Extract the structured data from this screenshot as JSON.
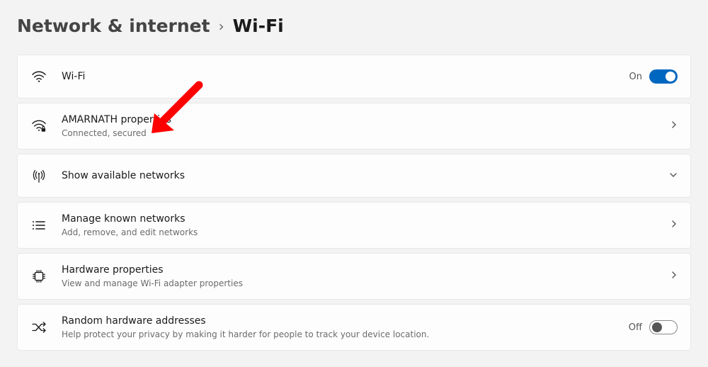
{
  "breadcrumb": {
    "parent": "Network & internet",
    "current": "Wi-Fi"
  },
  "cards": {
    "wifi": {
      "title": "Wi-Fi",
      "state_label": "On"
    },
    "net_props": {
      "title": "AMARNATH properties",
      "sub": "Connected, secured"
    },
    "show_networks": {
      "title": "Show available networks"
    },
    "manage_networks": {
      "title": "Manage known networks",
      "sub": "Add, remove, and edit networks"
    },
    "hardware": {
      "title": "Hardware properties",
      "sub": "View and manage Wi-Fi adapter properties"
    },
    "random_mac": {
      "title": "Random hardware addresses",
      "sub": "Help protect your privacy by making it harder for people to track your device location.",
      "state_label": "Off"
    }
  }
}
